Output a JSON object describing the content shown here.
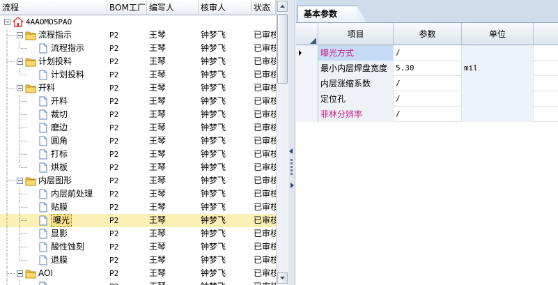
{
  "tree": {
    "columns": [
      "流程",
      "BOM工厂",
      "编写人",
      "核审人",
      "状态"
    ],
    "rows": [
      {
        "label": "4AAOMOSPAO",
        "level": 0,
        "type": "root",
        "expand": "minus",
        "bom": "",
        "author": "",
        "reviewer": "",
        "status": ""
      },
      {
        "label": "流程指示",
        "level": 1,
        "type": "folder",
        "expand": "minus",
        "bom": "P2",
        "author": "王琴",
        "reviewer": "钟梦飞",
        "status": "已审核"
      },
      {
        "label": "流程指示",
        "level": 2,
        "type": "doc",
        "expand": "",
        "bom": "P2",
        "author": "王琴",
        "reviewer": "钟梦飞",
        "status": "已审核"
      },
      {
        "label": "计划投料",
        "level": 1,
        "type": "folder",
        "expand": "minus",
        "bom": "P2",
        "author": "王琴",
        "reviewer": "钟梦飞",
        "status": "已审核"
      },
      {
        "label": "计划投料",
        "level": 2,
        "type": "doc",
        "expand": "",
        "bom": "P2",
        "author": "王琴",
        "reviewer": "钟梦飞",
        "status": "已审核"
      },
      {
        "label": "开料",
        "level": 1,
        "type": "folder",
        "expand": "minus",
        "bom": "P2",
        "author": "王琴",
        "reviewer": "钟梦飞",
        "status": "已审核"
      },
      {
        "label": "开料",
        "level": 2,
        "type": "doc",
        "expand": "",
        "bom": "P2",
        "author": "王琴",
        "reviewer": "钟梦飞",
        "status": "已审核"
      },
      {
        "label": "裁切",
        "level": 2,
        "type": "doc",
        "expand": "",
        "bom": "P2",
        "author": "王琴",
        "reviewer": "钟梦飞",
        "status": "已审核"
      },
      {
        "label": "磨边",
        "level": 2,
        "type": "doc",
        "expand": "",
        "bom": "P2",
        "author": "王琴",
        "reviewer": "钟梦飞",
        "status": "已审核"
      },
      {
        "label": "圆角",
        "level": 2,
        "type": "doc",
        "expand": "",
        "bom": "P2",
        "author": "王琴",
        "reviewer": "钟梦飞",
        "status": "已审核"
      },
      {
        "label": "打标",
        "level": 2,
        "type": "doc",
        "expand": "",
        "bom": "P2",
        "author": "王琴",
        "reviewer": "钟梦飞",
        "status": "已审核"
      },
      {
        "label": "烘板",
        "level": 2,
        "type": "doc",
        "expand": "",
        "bom": "P2",
        "author": "王琴",
        "reviewer": "钟梦飞",
        "status": "已审核"
      },
      {
        "label": "内层图形",
        "level": 1,
        "type": "folder",
        "expand": "minus",
        "bom": "P2",
        "author": "王琴",
        "reviewer": "钟梦飞",
        "status": "已审核"
      },
      {
        "label": "内层前处理",
        "level": 2,
        "type": "doc",
        "expand": "",
        "bom": "P2",
        "author": "王琴",
        "reviewer": "钟梦飞",
        "status": "已审核"
      },
      {
        "label": "贴膜",
        "level": 2,
        "type": "doc",
        "expand": "",
        "bom": "P2",
        "author": "王琴",
        "reviewer": "钟梦飞",
        "status": "已审核"
      },
      {
        "label": "曝光",
        "level": 2,
        "type": "doc",
        "expand": "",
        "bom": "P2",
        "author": "王琴",
        "reviewer": "钟梦飞",
        "status": "已审核",
        "selected": true
      },
      {
        "label": "显影",
        "level": 2,
        "type": "doc",
        "expand": "",
        "bom": "P2",
        "author": "王琴",
        "reviewer": "钟梦飞",
        "status": "已审核"
      },
      {
        "label": "酸性蚀刻",
        "level": 2,
        "type": "doc",
        "expand": "",
        "bom": "P2",
        "author": "王琴",
        "reviewer": "钟梦飞",
        "status": "已审核"
      },
      {
        "label": "退膜",
        "level": 2,
        "type": "doc",
        "expand": "",
        "bom": "P2",
        "author": "王琴",
        "reviewer": "钟梦飞",
        "status": "已审核"
      },
      {
        "label": "AOI",
        "level": 1,
        "type": "folder",
        "expand": "minus",
        "bom": "P2",
        "author": "王琴",
        "reviewer": "钟梦飞",
        "status": "已审核"
      },
      {
        "label": "",
        "level": 2,
        "type": "doc",
        "expand": "",
        "bom": "P2",
        "author": "王琴",
        "reviewer": "钟梦飞",
        "status": "已审核"
      }
    ]
  },
  "right": {
    "tab": "基本参数",
    "grid": {
      "columns": [
        "项目",
        "参数",
        "单位"
      ],
      "rows": [
        {
          "item": "曝光方式",
          "param": "/",
          "unit": "",
          "highlight": true,
          "active": true
        },
        {
          "item": "最小内层焊盘宽度",
          "param": "5.30",
          "unit": "mil",
          "highlight": false,
          "active": false
        },
        {
          "item": "内层涨缩系数",
          "param": "/",
          "unit": "",
          "highlight": false,
          "active": false
        },
        {
          "item": "定位孔",
          "param": "/",
          "unit": "",
          "highlight": false,
          "active": false
        },
        {
          "item": "菲林分辨率",
          "param": "/",
          "unit": "",
          "highlight": true,
          "active": false
        }
      ]
    }
  },
  "colors": {
    "selected_row": "#fdf0b4",
    "highlight_text": "#c8238a",
    "folder": "#f5c542",
    "root_icon": "#d9342b"
  }
}
